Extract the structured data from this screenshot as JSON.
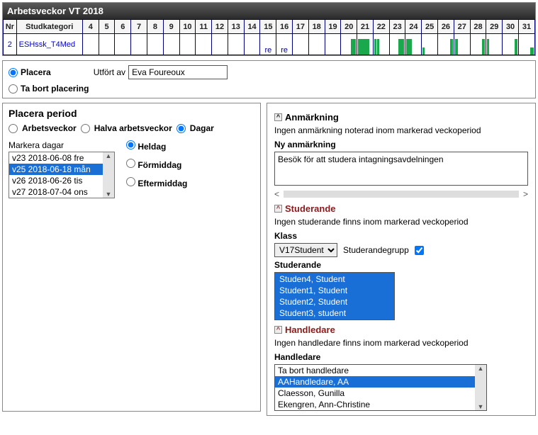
{
  "top": {
    "title": "Arbetsveckor VT 2018",
    "headers": [
      "Nr",
      "Studkategori",
      "4",
      "5",
      "6",
      "7",
      "8",
      "9",
      "10",
      "11",
      "12",
      "13",
      "14",
      "15",
      "16",
      "17",
      "18",
      "19",
      "20",
      "21",
      "22",
      "23",
      "24",
      "25",
      "26",
      "27",
      "28",
      "29",
      "30",
      "31"
    ],
    "row": {
      "nr": "2",
      "stud": "ESHssk_T4Med",
      "re": "re"
    }
  },
  "place": {
    "placera": "Placera",
    "tabort": "Ta bort placering",
    "utf_lbl": "Utfört av",
    "utf_val": "Eva Foureoux"
  },
  "period": {
    "title": "Placera period",
    "arbets": "Arbetsveckor",
    "halva": "Halva arbetsveckor",
    "dagar": "Dagar",
    "markera": "Markera dagar",
    "days": [
      "v23 2018-06-08 fre",
      "v25 2018-06-18 mån",
      "v26 2018-06-26 tis",
      "v27 2018-07-04 ons"
    ],
    "day_selected_index": 1,
    "part": {
      "heldag": "Heldag",
      "form": "Förmiddag",
      "eft": "Eftermiddag"
    }
  },
  "anm": {
    "title": "Anmärkning",
    "none": "Ingen anmärkning noterad inom markerad veckoperiod",
    "ny": "Ny anmärkning",
    "text": "Besök för att studera intagningsavdelningen"
  },
  "stud": {
    "title": "Studerande",
    "none": "Ingen studerande finns inom markerad veckoperiod",
    "klass_lbl": "Klass",
    "klass_val": "V17Student",
    "grp_lbl": "Studerandegrupp",
    "list_lbl": "Studerande",
    "list": [
      "Studen4, Student",
      "Student1, Student",
      "Student2, Student",
      "Student3, student"
    ]
  },
  "hand": {
    "title": "Handledare",
    "none": "Ingen handledare finns inom markerad veckoperiod",
    "lbl": "Handledare",
    "list": [
      "Ta bort handledare",
      "AAHandledare, AA",
      "Claesson, Gunilla",
      "Ekengren, Ann-Christine"
    ],
    "sel_index": 1
  }
}
